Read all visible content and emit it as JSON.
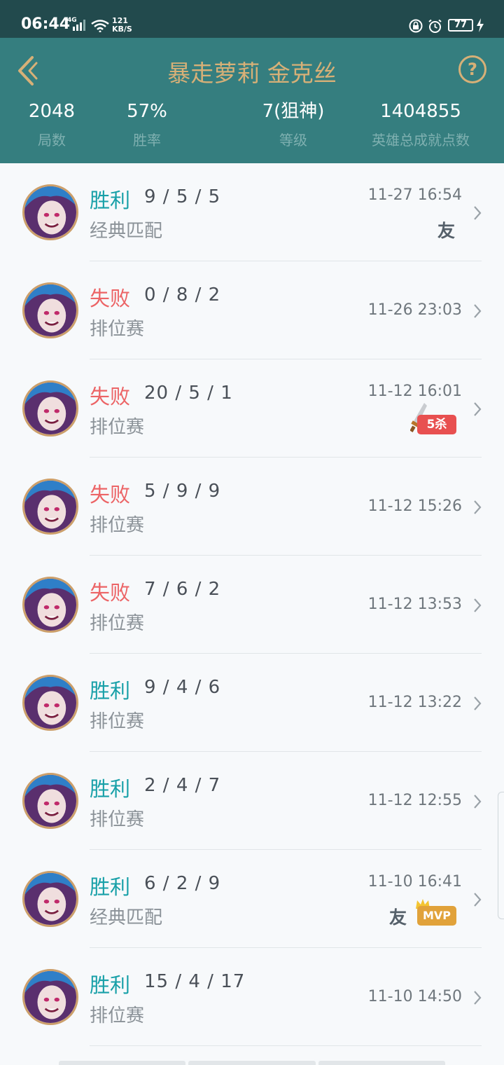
{
  "status_bar": {
    "time": "06:44",
    "network": "4G",
    "speed_value": "121",
    "speed_unit": "KB/S",
    "battery": "77"
  },
  "header": {
    "title": "暴走萝莉 金克丝",
    "stats": [
      {
        "value": "2048",
        "label": "局数"
      },
      {
        "value": "57%",
        "label": "胜率"
      },
      {
        "value": "7(狙神)",
        "label": "等级"
      },
      {
        "value": "1404855",
        "label": "英雄总成就点数"
      }
    ]
  },
  "matches": [
    {
      "result": "胜利",
      "outcome": "win",
      "kda": "9 / 5 / 5",
      "mode": "经典匹配",
      "date": "11-27 16:54",
      "friend": "友"
    },
    {
      "result": "失败",
      "outcome": "loss",
      "kda": "0 / 8 / 2",
      "mode": "排位赛",
      "date": "11-26 23:03"
    },
    {
      "result": "失败",
      "outcome": "loss",
      "kda": "20 / 5 / 1",
      "mode": "排位赛",
      "date": "11-12 16:01",
      "badge": "5杀"
    },
    {
      "result": "失败",
      "outcome": "loss",
      "kda": "5 / 9 / 9",
      "mode": "排位赛",
      "date": "11-12 15:26"
    },
    {
      "result": "失败",
      "outcome": "loss",
      "kda": "7 / 6 / 2",
      "mode": "排位赛",
      "date": "11-12 13:53"
    },
    {
      "result": "胜利",
      "outcome": "win",
      "kda": "9 / 4 / 6",
      "mode": "排位赛",
      "date": "11-12 13:22"
    },
    {
      "result": "胜利",
      "outcome": "win",
      "kda": "2 / 4 / 7",
      "mode": "排位赛",
      "date": "11-12 12:55"
    },
    {
      "result": "胜利",
      "outcome": "win",
      "kda": "6 / 2 / 9",
      "mode": "经典匹配",
      "date": "11-10 16:41",
      "friend": "友",
      "badge": "MVP"
    },
    {
      "result": "胜利",
      "outcome": "win",
      "kda": "15 / 4 / 17",
      "mode": "排位赛",
      "date": "11-10 14:50"
    }
  ],
  "colors": {
    "header_bg": "#357e7f",
    "statusbar_bg": "#224a4d",
    "title_gold": "#d7b077",
    "win": "#18a0a8",
    "loss": "#ec6466",
    "kill_badge": "#e85050",
    "mvp_badge": "#e1a23a"
  },
  "icons": {
    "back": "chevron-left-icon",
    "help": "question-circle-icon",
    "row_arrow": "chevron-right-icon",
    "avatar": "jinx-champion-portrait"
  }
}
